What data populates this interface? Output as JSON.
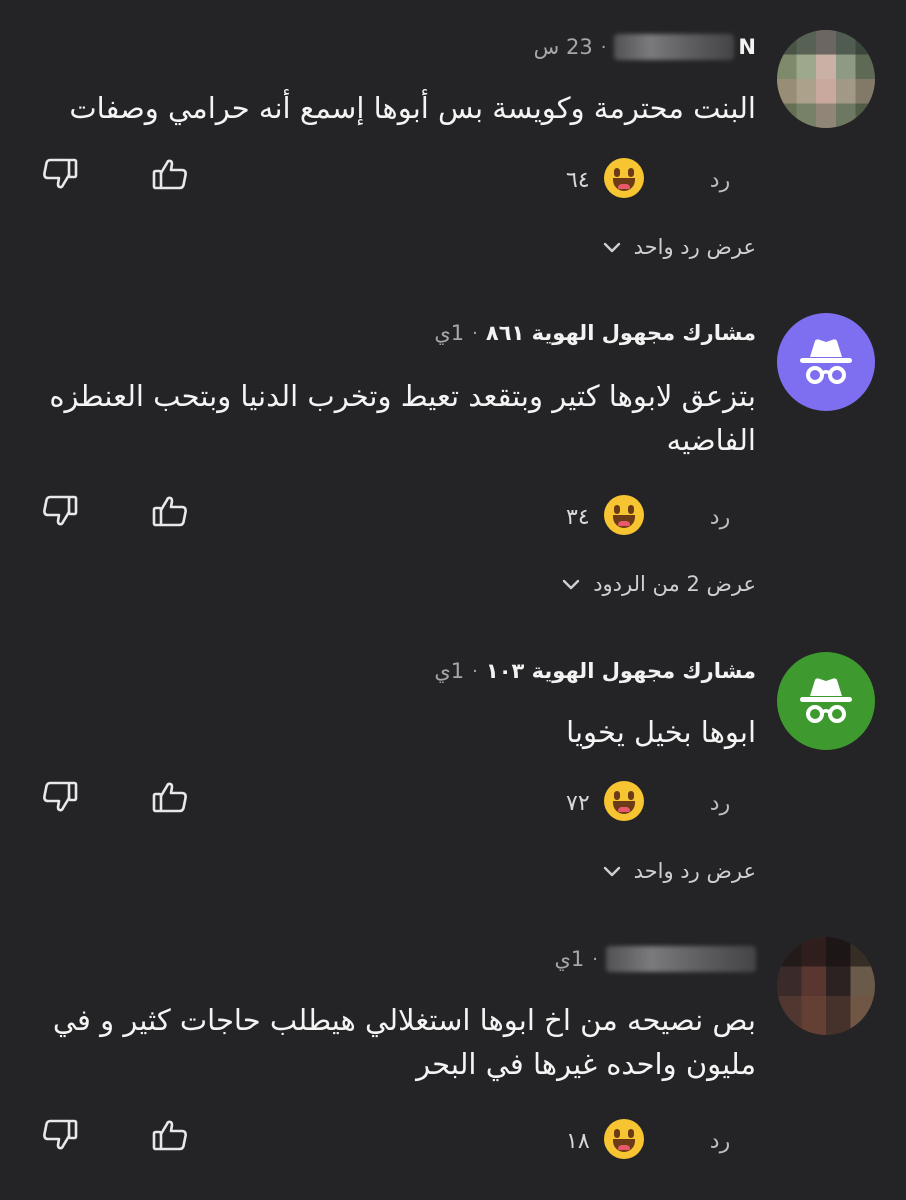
{
  "comments": [
    {
      "author_visible": "N",
      "time": "23 س",
      "text": "البنت محترمة وكويسة بس أبوها إسمع أنه حرامي وصفات",
      "reaction_count": "٦٤",
      "reply_label": "رد",
      "replies_link": "عرض رد واحد"
    },
    {
      "author": "مشارك مجهول الهوية ٨٦١",
      "time": "1ي",
      "text": "بتزعق لابوها كتير وبتقعد تعيط وتخرب الدنيا وبتحب العنطزه الفاضيه",
      "reaction_count": "٣٤",
      "reply_label": "رد",
      "replies_link": "عرض 2 من الردود"
    },
    {
      "author": "مشارك مجهول الهوية ١٠٣",
      "time": "1ي",
      "text": "ابوها بخيل يخويا",
      "reaction_count": "٧٢",
      "reply_label": "رد",
      "replies_link": "عرض رد واحد"
    },
    {
      "author_visible": "",
      "time": "1ي",
      "text": "بص نصيحه من اخ ابوها استغلالي هيطلب حاجات كثير و في مليون واحده غيرها في البحر",
      "reaction_count": "١٨",
      "reply_label": "رد"
    }
  ],
  "separator": "·",
  "icons": {
    "like": "thumbs-up-icon",
    "dislike": "thumbs-down-icon",
    "reaction": "grinning-emoji-icon",
    "anonymous": "incognito-icon",
    "expand": "chevron-down-icon"
  },
  "colors": {
    "background": "#242426",
    "anon_avatar_1": "#7d6ff0",
    "anon_avatar_2": "#3e9a2f",
    "emoji": "#f7c531"
  }
}
